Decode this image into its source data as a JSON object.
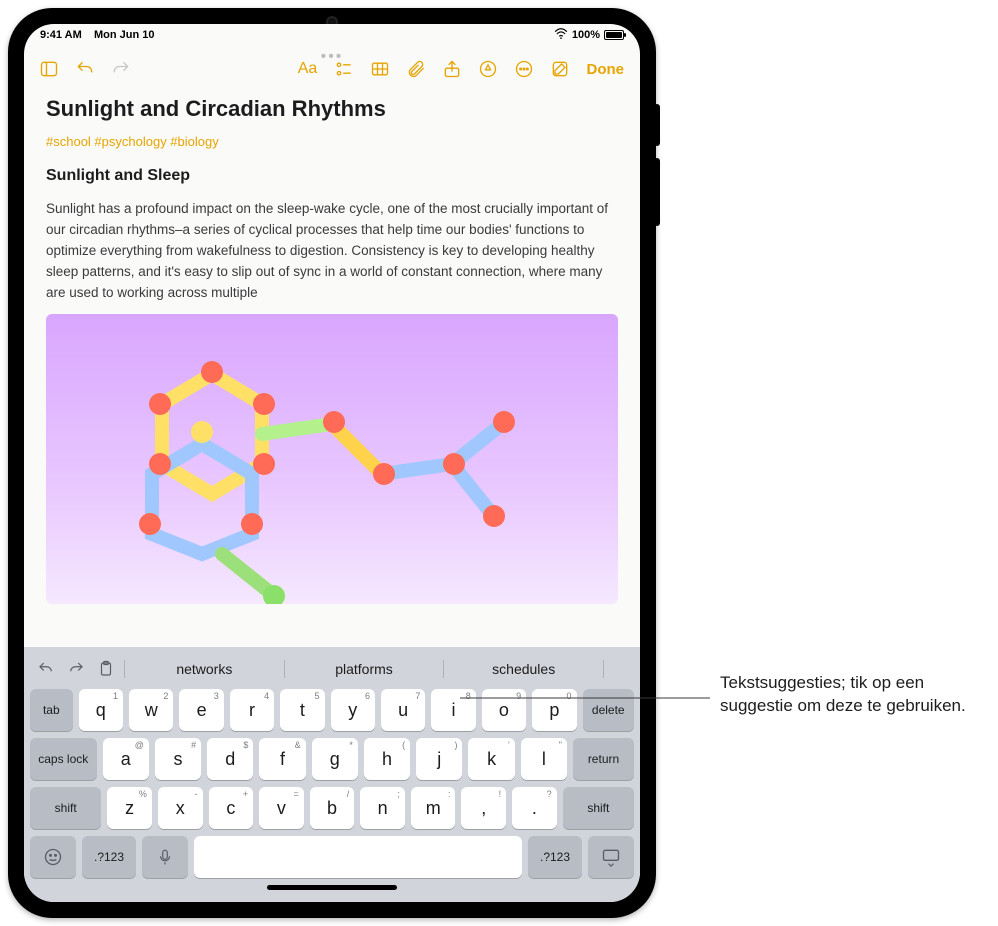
{
  "status": {
    "time": "9:41 AM",
    "date": "Mon Jun 10",
    "battery_pct": "100%",
    "wifi_icon": "wifi-icon"
  },
  "toolbar": {
    "aa_label": "Aa",
    "done_label": "Done"
  },
  "note": {
    "title": "Sunlight and Circadian Rhythms",
    "tags": "#school #psychology #biology",
    "subheading": "Sunlight and Sleep",
    "body": "Sunlight has a profound impact on the sleep-wake cycle, one of the most crucially important of our circadian rhythms–a series of cyclical processes that help time our bodies' functions to optimize everything from wakefulness to digestion. Consistency is key to developing healthy sleep patterns, and it's easy to slip out of sync in a world of constant connection, where many are used to working across multiple"
  },
  "suggestions": [
    "networks",
    "platforms",
    "schedules"
  ],
  "keys": {
    "row1": [
      {
        "main": "q",
        "hint": "1"
      },
      {
        "main": "w",
        "hint": "2"
      },
      {
        "main": "e",
        "hint": "3"
      },
      {
        "main": "r",
        "hint": "4"
      },
      {
        "main": "t",
        "hint": "5"
      },
      {
        "main": "y",
        "hint": "6"
      },
      {
        "main": "u",
        "hint": "7"
      },
      {
        "main": "i",
        "hint": "8"
      },
      {
        "main": "o",
        "hint": "9"
      },
      {
        "main": "p",
        "hint": "0"
      }
    ],
    "row2": [
      {
        "main": "a",
        "hint": "@"
      },
      {
        "main": "s",
        "hint": "#"
      },
      {
        "main": "d",
        "hint": "$"
      },
      {
        "main": "f",
        "hint": "&"
      },
      {
        "main": "g",
        "hint": "*"
      },
      {
        "main": "h",
        "hint": "("
      },
      {
        "main": "j",
        "hint": ")"
      },
      {
        "main": "k",
        "hint": "'"
      },
      {
        "main": "l",
        "hint": "\""
      }
    ],
    "row3": [
      {
        "main": "z",
        "hint": "%"
      },
      {
        "main": "x",
        "hint": "-"
      },
      {
        "main": "c",
        "hint": "+"
      },
      {
        "main": "v",
        "hint": "="
      },
      {
        "main": "b",
        "hint": "/"
      },
      {
        "main": "n",
        "hint": ";"
      },
      {
        "main": "m",
        "hint": ":"
      },
      {
        "main": ",",
        "hint": "!"
      },
      {
        "main": ".",
        "hint": "?"
      }
    ],
    "tab": "tab",
    "delete": "delete",
    "caps": "caps lock",
    "return": "return",
    "shift": "shift",
    "numsym": ".?123"
  },
  "callout": {
    "text": "Tekstsuggesties; tik op een suggestie om deze te gebruiken."
  },
  "colors": {
    "accent": "#e6a400",
    "keyboard_bg": "#d1d4da"
  }
}
